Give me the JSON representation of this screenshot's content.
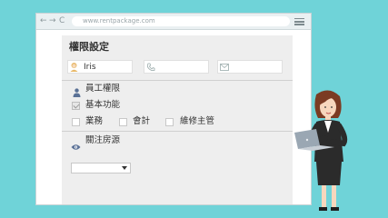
{
  "browser": {
    "url": "www.rentpackage.com",
    "nav_back": "←",
    "nav_forward": "→",
    "nav_reload": "C"
  },
  "form": {
    "title": "權限設定",
    "name_value": "Iris",
    "phone_value": "",
    "email_value": "",
    "section_staff": "員工權限",
    "basic_function": "基本功能",
    "checkboxes": [
      {
        "label": "業務",
        "checked": false
      },
      {
        "label": "會計",
        "checked": false
      },
      {
        "label": "維修主管",
        "checked": false
      }
    ],
    "section_follow": "關注房源",
    "follow_select_value": ""
  },
  "colors": {
    "background": "#6fd3d8",
    "panel": "#eeeeee",
    "accent_icon": "#4a6a9a"
  }
}
